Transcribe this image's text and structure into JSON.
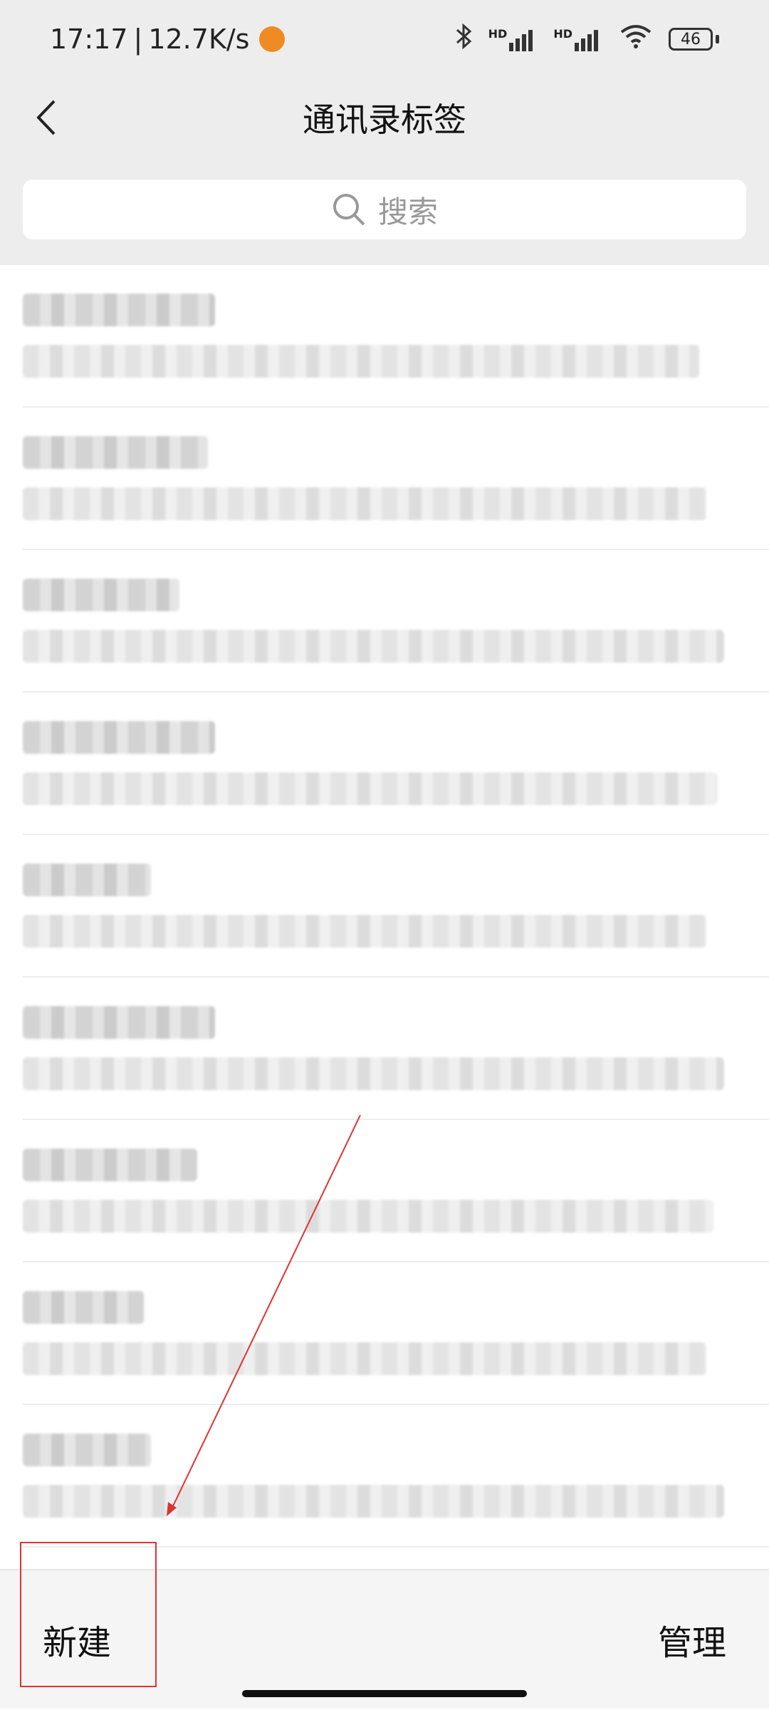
{
  "status": {
    "time": "17:17",
    "speed": "12.7K/s",
    "battery": "46",
    "network1": "HD",
    "network2": "HD"
  },
  "nav": {
    "title": "通讯录标签"
  },
  "search": {
    "placeholder": "搜索"
  },
  "tags": [
    {
      "title": "",
      "subtitle": ""
    },
    {
      "title": "",
      "subtitle": ""
    },
    {
      "title": "",
      "subtitle": ""
    },
    {
      "title": "",
      "subtitle": ""
    },
    {
      "title": "",
      "subtitle": ""
    },
    {
      "title": "",
      "subtitle": ""
    },
    {
      "title": "",
      "subtitle": ""
    },
    {
      "title": "",
      "subtitle": ""
    },
    {
      "title": "",
      "subtitle": ""
    }
  ],
  "bottom": {
    "new_label": "新建",
    "manage_label": "管理"
  },
  "colors": {
    "bar_bg": "#ededed",
    "accent_red": "#dd3333"
  }
}
